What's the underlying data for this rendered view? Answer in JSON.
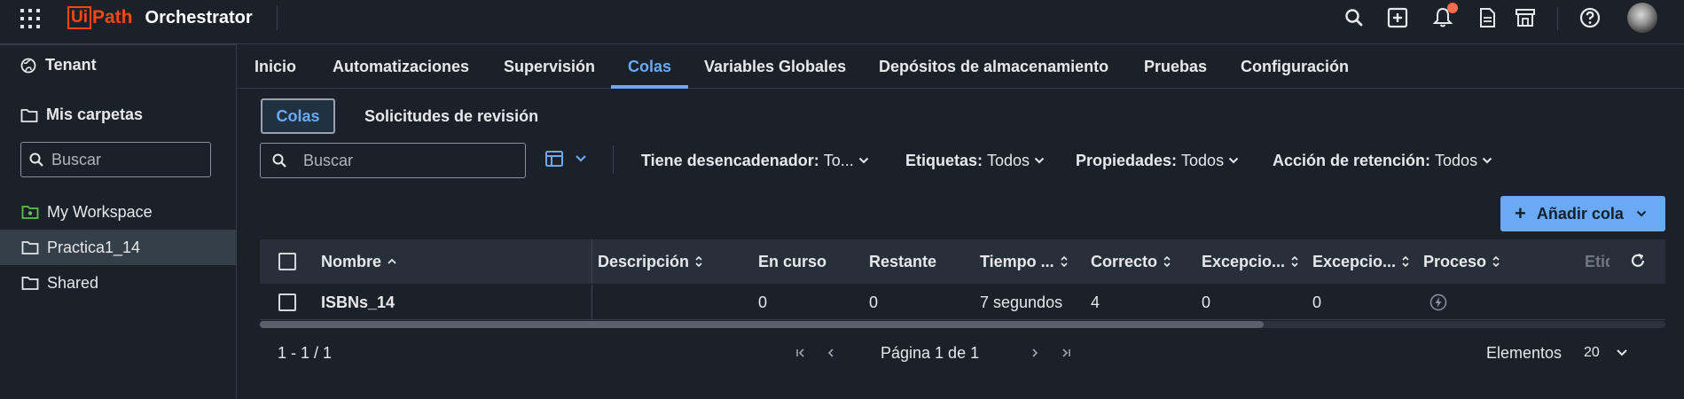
{
  "topbar": {
    "brand_ui": "Ui",
    "brand_path": "Path",
    "product": "Orchestrator",
    "icons": [
      "apps-grid-icon",
      "search-icon",
      "add-square-icon",
      "bell-icon",
      "document-icon",
      "store-icon",
      "help-icon",
      "avatar"
    ]
  },
  "sidebar": {
    "tenant_label": "Tenant",
    "my_folders_label": "Mis carpetas",
    "search_placeholder": "Buscar",
    "folders": [
      {
        "label": "My Workspace",
        "icon": "workspace-folder-icon",
        "icon_color": "#5fbf4f"
      },
      {
        "label": "Practica1_14",
        "icon": "folder-icon",
        "selected": true
      },
      {
        "label": "Shared",
        "icon": "folder-icon"
      }
    ]
  },
  "nav": {
    "tabs": [
      "Inicio",
      "Automatizaciones",
      "Supervisión",
      "Colas",
      "Variables Globales",
      "Depósitos de almacenamiento",
      "Pruebas",
      "Configuración"
    ],
    "active": "Colas"
  },
  "subtabs": {
    "selected": "Colas",
    "other": "Solicitudes de revisión"
  },
  "filters": {
    "search_placeholder": "Buscar",
    "trigger_label": "Tiene desencadenador:",
    "trigger_value": "To...",
    "tags_label": "Etiquetas:",
    "tags_value": "Todos",
    "props_label": "Propiedades:",
    "props_value": "Todos",
    "retention_label": "Acción de retención:",
    "retention_value": "Todos"
  },
  "add_button": {
    "label": "Añadir cola"
  },
  "table": {
    "headers": {
      "name": "Nombre",
      "description": "Descripción",
      "in_progress": "En curso",
      "remaining": "Restante",
      "time": "Tiempo ...",
      "successful": "Correcto",
      "exceptions1": "Excepcio...",
      "exceptions2": "Excepcio...",
      "process": "Proceso",
      "tags": "Etiq"
    },
    "rows": [
      {
        "name": "ISBNs_14",
        "description": "",
        "in_progress": "0",
        "remaining": "0",
        "time": "7 segundos",
        "successful": "4",
        "exceptions1": "0",
        "exceptions2": "0",
        "process_icon": "trigger-bolt-icon"
      }
    ]
  },
  "footer": {
    "range": "1 - 1 / 1",
    "page_text": "Página 1 de 1",
    "items_label": "Elementos",
    "items_value": "20"
  },
  "colors": {
    "accent": "#6aa9f4",
    "brand": "#fa4616",
    "background": "#1b2129"
  }
}
